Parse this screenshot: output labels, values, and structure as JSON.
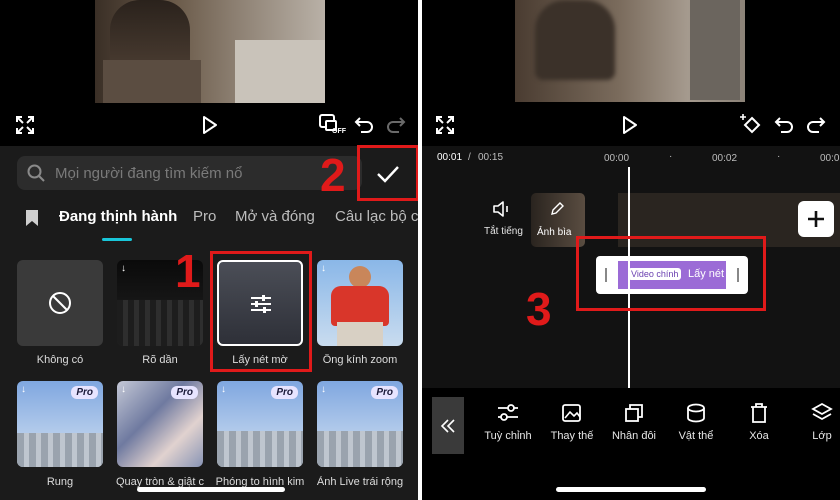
{
  "left_panel": {
    "search": {
      "placeholder": "Mọi người đang tìm kiếm nổ"
    },
    "tabs": [
      "Đang thịnh hành",
      "Pro",
      "Mở và đóng",
      "Câu lạc bộ c"
    ],
    "effects_row1": [
      {
        "label": "Không có"
      },
      {
        "label": "Rõ dần"
      },
      {
        "label": "Lấy nét mờ"
      },
      {
        "label": "Ống kính zoom"
      }
    ],
    "effects_row2": [
      {
        "label": "Rung",
        "pro": "Pro"
      },
      {
        "label": "Quay tròn & giật c",
        "pro": "Pro"
      },
      {
        "label": "Phóng to hình kim",
        "pro": "Pro"
      },
      {
        "label": "Ảnh Live trái rộng",
        "pro": "Pro"
      }
    ],
    "controls": {
      "off_label": "OFF"
    }
  },
  "right_panel": {
    "time": {
      "current": "00:01",
      "separator": "/",
      "total": "00:15"
    },
    "ruler": [
      "00:00",
      "00:02",
      "00:0"
    ],
    "mute_label": "Tắt tiếng",
    "cover_label": "Ảnh bìa",
    "effect_clip": {
      "tag": "Video chính",
      "name": "Lấy nét"
    },
    "toolbar": [
      {
        "label": "Tuỳ chỉnh",
        "icon": "sliders-icon"
      },
      {
        "label": "Thay thế",
        "icon": "replace-icon"
      },
      {
        "label": "Nhân đôi",
        "icon": "duplicate-icon"
      },
      {
        "label": "Vật thể",
        "icon": "object-icon"
      },
      {
        "label": "Xóa",
        "icon": "trash-icon"
      },
      {
        "label": "Lớp",
        "icon": "layers-icon"
      }
    ]
  },
  "annotations": {
    "n1": "1",
    "n2": "2",
    "n3": "3"
  },
  "colors": {
    "annotation_red": "#e01a1a",
    "tab_accent": "#19c6d9",
    "effect_clip": "#9b6bd6"
  }
}
